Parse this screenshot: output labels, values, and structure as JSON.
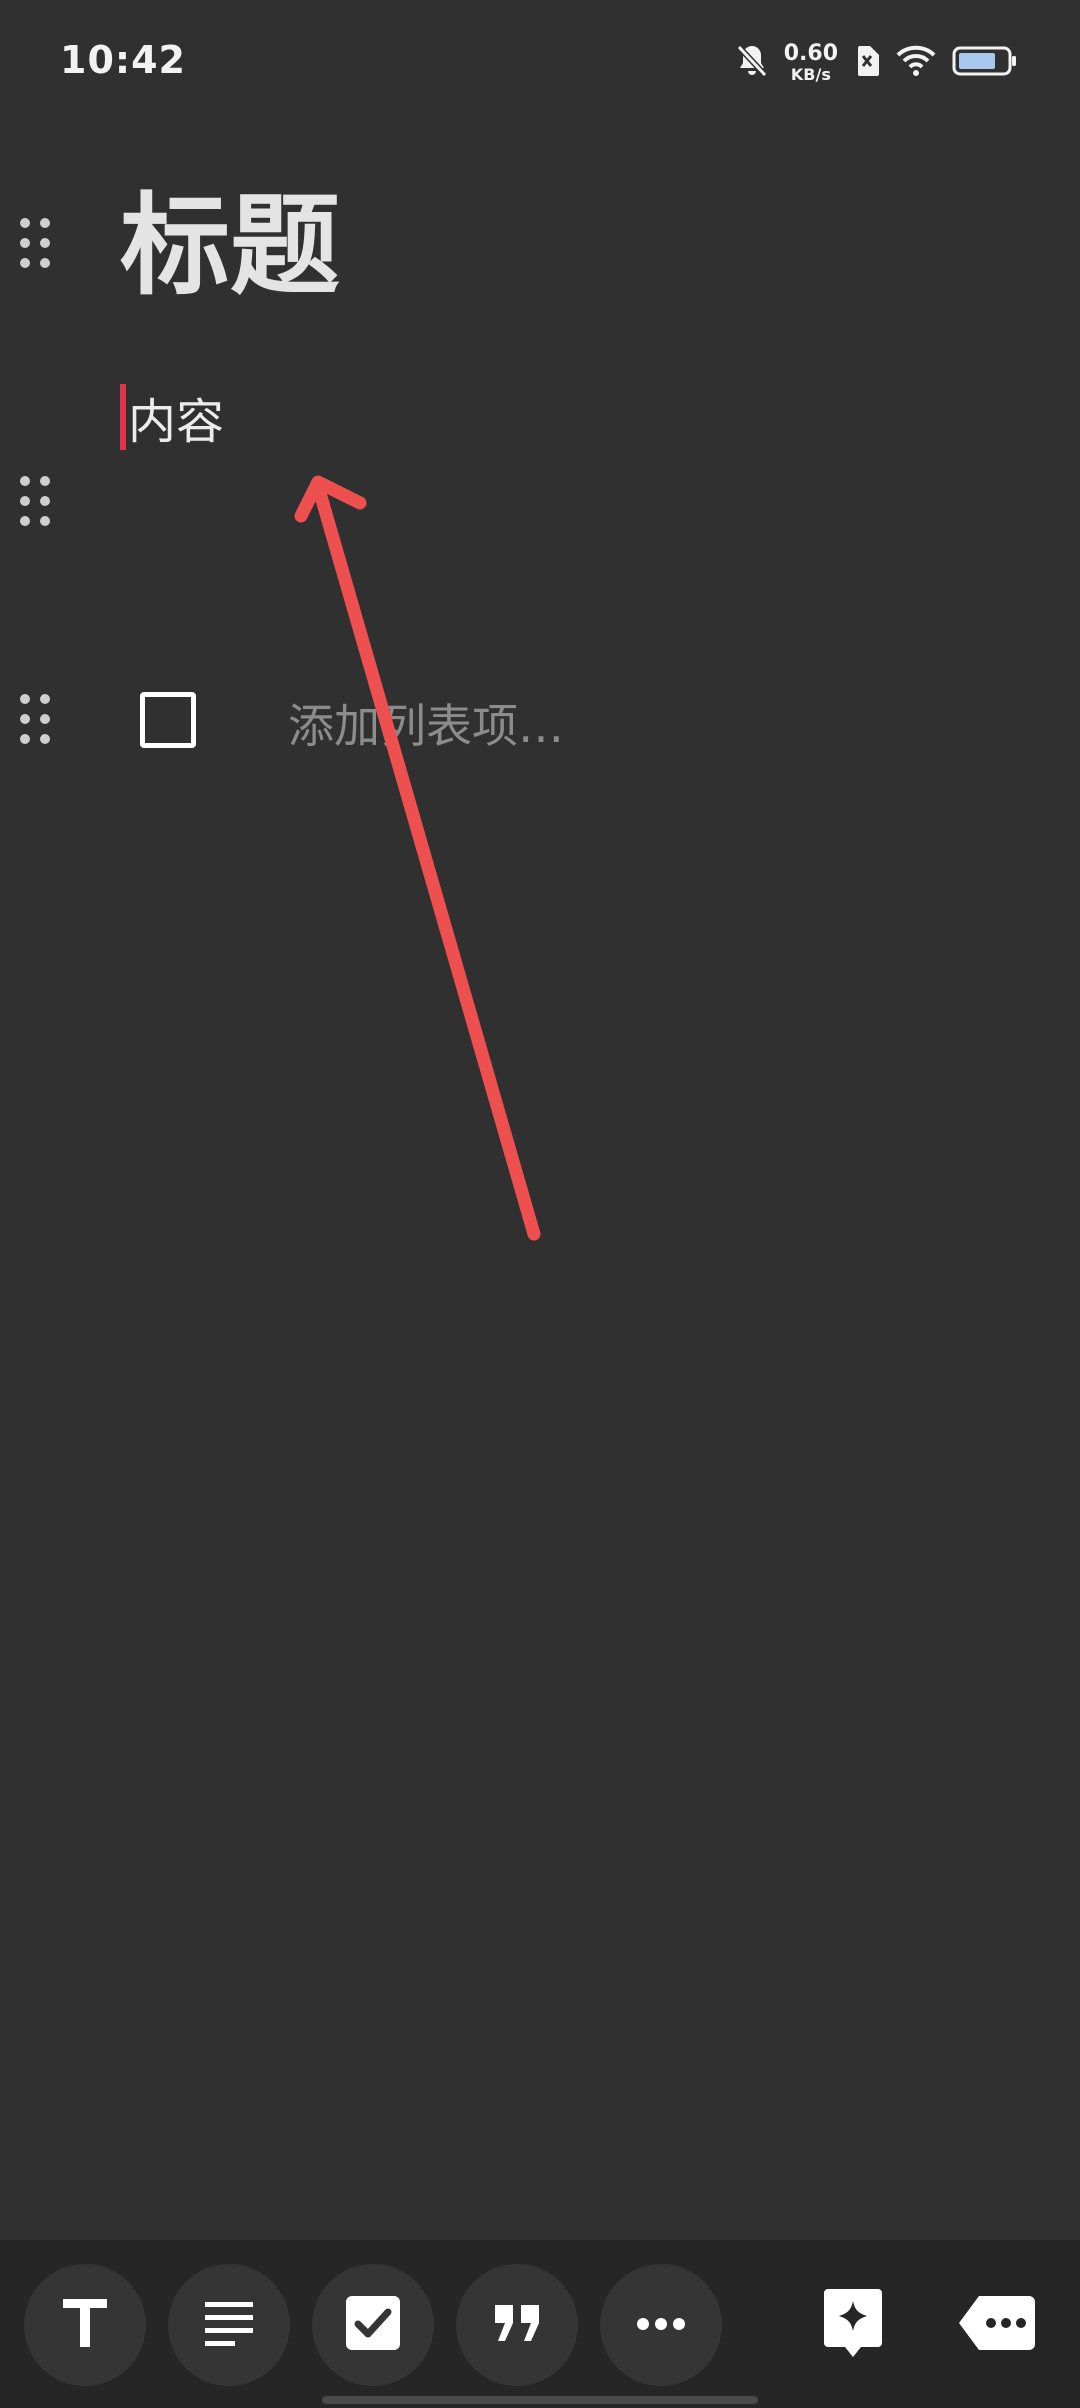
{
  "status_bar": {
    "time": "10:42",
    "net_speed_value": "0.60",
    "net_speed_unit": "KB/s",
    "battery_level": 0.8,
    "icons": [
      "mute-bell-icon",
      "sim-off-icon",
      "wifi-icon",
      "battery-icon"
    ]
  },
  "note": {
    "title": "标题",
    "content": "内容"
  },
  "checklist": {
    "placeholder": "添加列表项…"
  },
  "toolbar": {
    "buttons": [
      "text-format-icon",
      "paragraph-icon",
      "checkbox-icon",
      "quote-icon",
      "more-icon",
      "ai-sparkle-icon",
      "keyboard-backspace-icon"
    ]
  },
  "colors": {
    "background": "#313031",
    "toolbar": "#262626",
    "button": "#353535",
    "cursor": "#e0344f",
    "annotation_arrow": "#ee4f4f",
    "placeholder": "#8c8c8c"
  }
}
